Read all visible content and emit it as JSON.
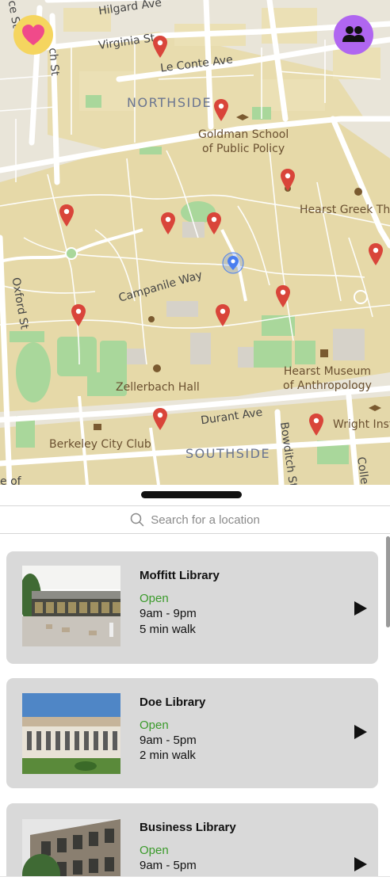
{
  "map": {
    "streets": {
      "hilgard": "Hilgard Ave",
      "virginia": "Virginia St",
      "leconte": "Le Conte Ave",
      "campanile": "Campanile Way",
      "durant": "Durant Ave",
      "bowditch": "Bowditch St",
      "oxford": "Oxford St",
      "college": "Colle",
      "leftTop": "ce St",
      "leftTop2": "ch St",
      "leftBottom": "e of"
    },
    "areas": {
      "northside": "NORTHSIDE",
      "southside": "SOUTHSIDE"
    },
    "places": {
      "goldman": "Goldman School\nof Public Policy",
      "hearstGreek": "Hearst Greek The",
      "hearstMuseum": "Hearst Museum\nof Anthropology",
      "zellerbach": "Zellerbach Hall",
      "cityClub": "Berkeley City Club",
      "wright": "Wright Inst"
    },
    "pinColor": "#d9453a",
    "youColor": "#4a7ef0"
  },
  "buttons": {
    "favorites_icon": "heart-icon",
    "friends_icon": "people-icon"
  },
  "search": {
    "placeholder": "Search for a location",
    "icon": "search-icon"
  },
  "libraries": [
    {
      "name": "Moffitt Library",
      "status": "Open",
      "hours": "9am - 9pm",
      "walk": "5 min walk"
    },
    {
      "name": "Doe Library",
      "status": "Open",
      "hours": "9am - 5pm",
      "walk": "2 min walk"
    },
    {
      "name": "Business Library",
      "status": "Open",
      "hours": "9am - 5pm",
      "walk": ""
    }
  ],
  "colors": {
    "open": "#3a9a2a",
    "card": "#d9d9d9",
    "fav": "#f5d55f",
    "friends": "#b066f0"
  }
}
